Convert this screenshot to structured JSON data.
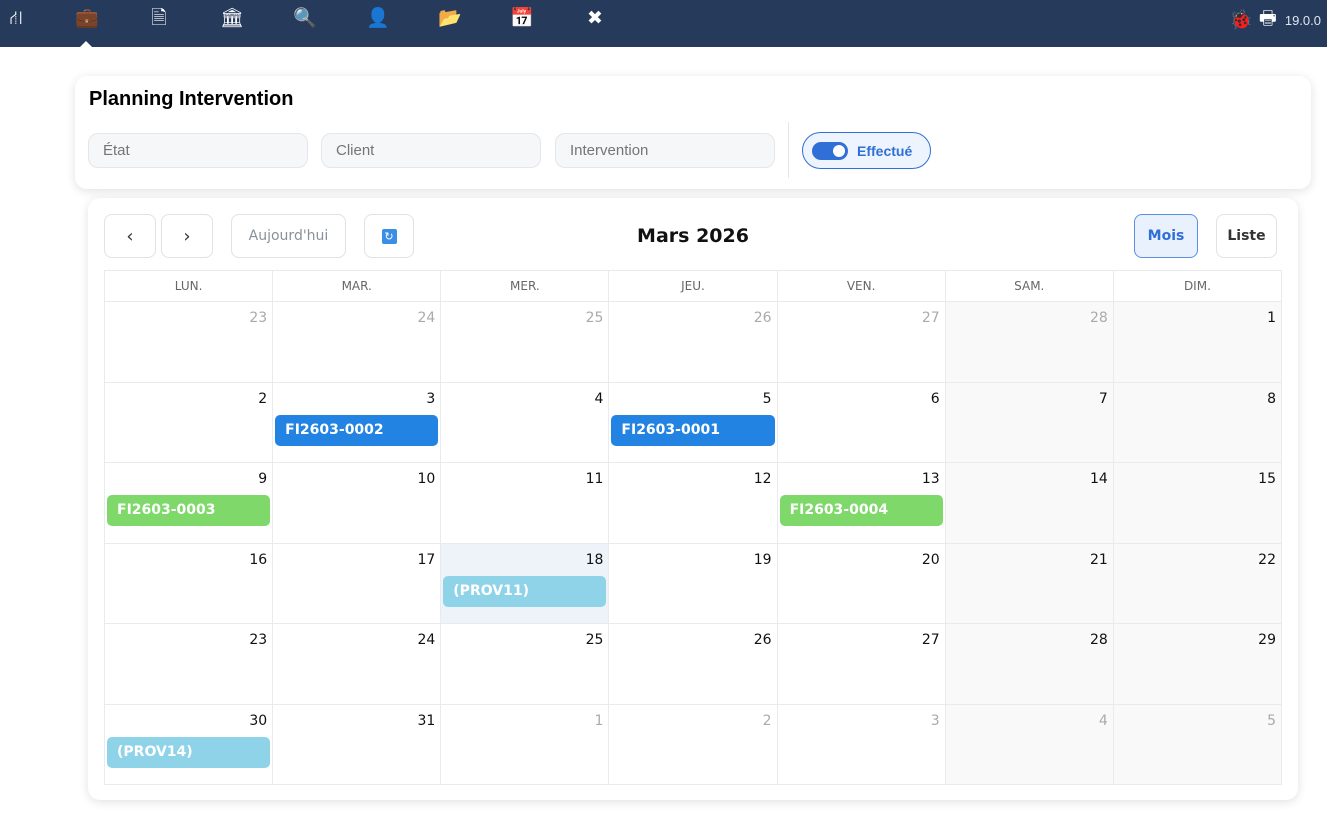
{
  "topbar": {
    "icons": [
      "sitemap-icon",
      "briefcase-icon",
      "invoice-icon",
      "bank-icon",
      "search-dollar-icon",
      "user-tie-icon",
      "folder-open-icon",
      "calendar-icon",
      "tools-icon"
    ],
    "version": "19.0.0"
  },
  "filters": {
    "title": "Planning Intervention",
    "etat_placeholder": "État",
    "client_placeholder": "Client",
    "intervention_placeholder": "Intervention",
    "toggle_label": "Effectué",
    "toggle_on": true
  },
  "calendar": {
    "today_label": "Aujourd'hui",
    "title": "Mars 2026",
    "view_month": "Mois",
    "view_list": "Liste",
    "colors": {
      "blue": "#2383e2",
      "green": "#7ed96a",
      "light": "#8fd3e8"
    },
    "weekdays": [
      "LUN.",
      "MAR.",
      "MER.",
      "JEU.",
      "VEN.",
      "SAM.",
      "DIM."
    ],
    "weeks": [
      [
        {
          "n": "23",
          "other": true
        },
        {
          "n": "24",
          "other": true
        },
        {
          "n": "25",
          "other": true
        },
        {
          "n": "26",
          "other": true
        },
        {
          "n": "27",
          "other": true
        },
        {
          "n": "28",
          "other": true
        },
        {
          "n": "1"
        }
      ],
      [
        {
          "n": "2"
        },
        {
          "n": "3",
          "events": [
            {
              "label": "FI2603-0002",
              "color": "blue"
            }
          ]
        },
        {
          "n": "4"
        },
        {
          "n": "5",
          "events": [
            {
              "label": "FI2603-0001",
              "color": "blue"
            }
          ]
        },
        {
          "n": "6"
        },
        {
          "n": "7"
        },
        {
          "n": "8"
        }
      ],
      [
        {
          "n": "9",
          "events": [
            {
              "label": "FI2603-0003",
              "color": "green"
            }
          ]
        },
        {
          "n": "10"
        },
        {
          "n": "11"
        },
        {
          "n": "12"
        },
        {
          "n": "13",
          "events": [
            {
              "label": "FI2603-0004",
              "color": "green"
            }
          ]
        },
        {
          "n": "14"
        },
        {
          "n": "15"
        }
      ],
      [
        {
          "n": "16"
        },
        {
          "n": "17"
        },
        {
          "n": "18",
          "today": true,
          "events": [
            {
              "label": "(PROV11)",
              "color": "light"
            }
          ]
        },
        {
          "n": "19"
        },
        {
          "n": "20"
        },
        {
          "n": "21"
        },
        {
          "n": "22"
        }
      ],
      [
        {
          "n": "23"
        },
        {
          "n": "24"
        },
        {
          "n": "25"
        },
        {
          "n": "26"
        },
        {
          "n": "27"
        },
        {
          "n": "28"
        },
        {
          "n": "29"
        }
      ],
      [
        {
          "n": "30",
          "events": [
            {
              "label": "(PROV14)",
              "color": "light"
            }
          ]
        },
        {
          "n": "31"
        },
        {
          "n": "1",
          "other": true
        },
        {
          "n": "2",
          "other": true
        },
        {
          "n": "3",
          "other": true
        },
        {
          "n": "4",
          "other": true
        },
        {
          "n": "5",
          "other": true
        }
      ]
    ]
  }
}
